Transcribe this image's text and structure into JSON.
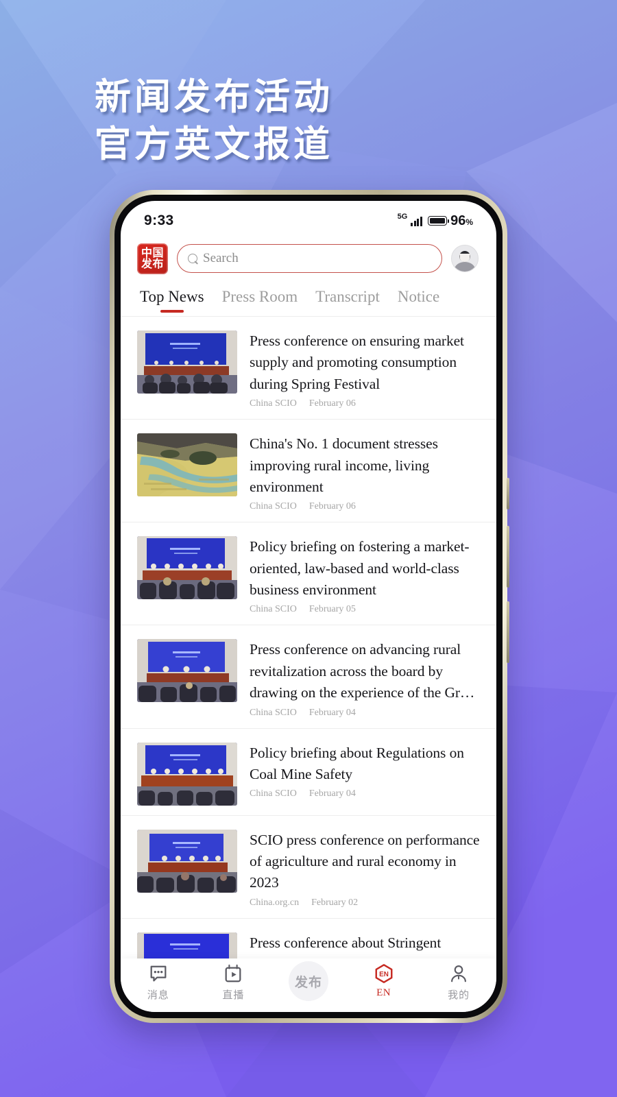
{
  "poster": {
    "headline_line1": "新闻发布活动",
    "headline_line2": "官方英文报道",
    "bg_top_color": "#8fb0e8",
    "bg_bottom_color": "#7b62ee"
  },
  "status_bar": {
    "time": "9:33",
    "network": "5G",
    "battery_percent": "96",
    "percent_symbol": "%"
  },
  "header": {
    "logo_line1": "中国",
    "logo_line2": "发布",
    "logo_color": "#c5221c",
    "search_placeholder": "Search",
    "search_value": "",
    "search_icon": "search-icon",
    "avatar_icon": "user-avatar-icon"
  },
  "tabs": {
    "accent_color": "#c62a22",
    "items": [
      {
        "label": "Top News",
        "active": true
      },
      {
        "label": "Press Room",
        "active": false
      },
      {
        "label": "Transcript",
        "active": false
      },
      {
        "label": "Notice",
        "active": false
      }
    ]
  },
  "news": {
    "items": [
      {
        "title": "Press conference on ensuring market supply and promoting consumption during Spring Festival",
        "source": "China SCIO",
        "date": "February 06",
        "thumb": "press-conference"
      },
      {
        "title": "China's No. 1 document stresses improving rural income, living environment",
        "source": "China SCIO",
        "date": "February 06",
        "thumb": "rural-landscape"
      },
      {
        "title": "Policy briefing on fostering a market-oriented, law-based and world-class business environment",
        "source": "China SCIO",
        "date": "February 05",
        "thumb": "press-conference"
      },
      {
        "title": "Press conference on advancing rural revitalization across the board by drawing on the experience of the Gr…",
        "source": "China SCIO",
        "date": "February 04",
        "thumb": "press-conference"
      },
      {
        "title": "Policy briefing about Regulations on Coal Mine Safety",
        "source": "China SCIO",
        "date": "February 04",
        "thumb": "press-conference"
      },
      {
        "title": "SCIO press conference on performance of agriculture and rural economy in 2023",
        "source": "China.org.cn",
        "date": "February 02",
        "thumb": "press-conference"
      },
      {
        "title": "Press conference about Stringent Measures on Preventing and Curbing",
        "source": "",
        "date": "",
        "thumb": "press-conference"
      }
    ]
  },
  "bottom_nav": {
    "items": [
      {
        "label": "消息",
        "icon": "message-icon"
      },
      {
        "label": "直播",
        "icon": "live-video-icon"
      },
      {
        "label": "发布",
        "icon": "publish-icon"
      },
      {
        "label": "EN",
        "icon": "en-language-icon"
      },
      {
        "label": "我的",
        "icon": "profile-icon"
      }
    ]
  }
}
